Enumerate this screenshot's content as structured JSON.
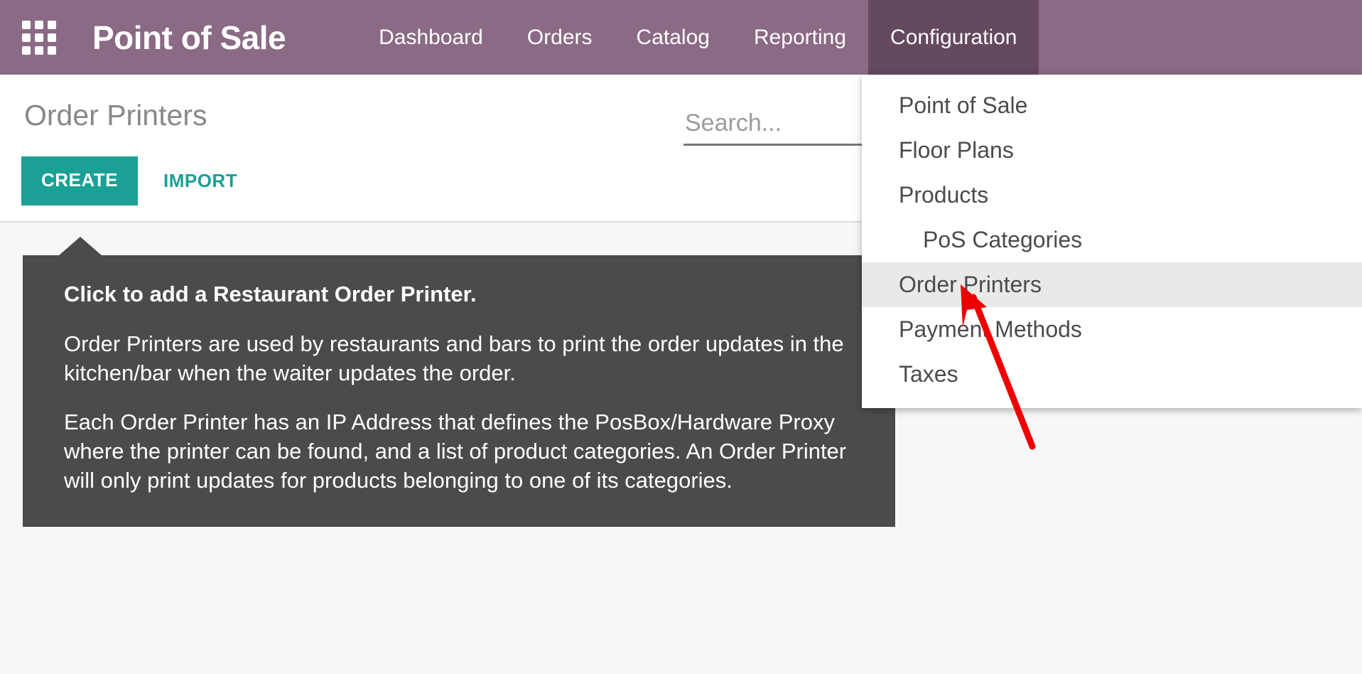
{
  "topbar": {
    "apps_icon": "apps-grid-icon",
    "brand": "Point of Sale",
    "background_color": "#8b6a85",
    "active_color": "#65495f",
    "nav": [
      {
        "label": "Dashboard",
        "active": false
      },
      {
        "label": "Orders",
        "active": false
      },
      {
        "label": "Catalog",
        "active": false
      },
      {
        "label": "Reporting",
        "active": false
      },
      {
        "label": "Configuration",
        "active": true
      }
    ]
  },
  "control_panel": {
    "page_title": "Order Printers",
    "create_label": "CREATE",
    "import_label": "IMPORT",
    "create_color": "#1aa094"
  },
  "search": {
    "value": "",
    "placeholder": "Search..."
  },
  "help": {
    "title": "Click to add a Restaurant Order Printer.",
    "paragraph_1": "Order Printers are used by restaurants and bars to print the order updates in the kitchen/bar when the waiter updates the order.",
    "paragraph_2": "Each Order Printer has an IP Address that defines the PosBox/Hardware Proxy where the printer can be found, and a list of product categories. An Order Printer will only print updates for products belonging to one of its categories.",
    "background_color": "#4b4b4b"
  },
  "dropdown": {
    "items": [
      {
        "label": "Point of Sale",
        "indent": false,
        "highlight": false
      },
      {
        "label": "Floor Plans",
        "indent": false,
        "highlight": false
      },
      {
        "label": "Products",
        "indent": false,
        "highlight": false
      },
      {
        "label": "PoS Categories",
        "indent": true,
        "highlight": false
      },
      {
        "label": "Order Printers",
        "indent": false,
        "highlight": true
      },
      {
        "label": "Payment Methods",
        "indent": false,
        "highlight": false
      },
      {
        "label": "Taxes",
        "indent": false,
        "highlight": false
      }
    ],
    "highlight_color": "#e9e9e9"
  },
  "annotation": {
    "color": "#ef0000",
    "target": "Order Printers"
  }
}
